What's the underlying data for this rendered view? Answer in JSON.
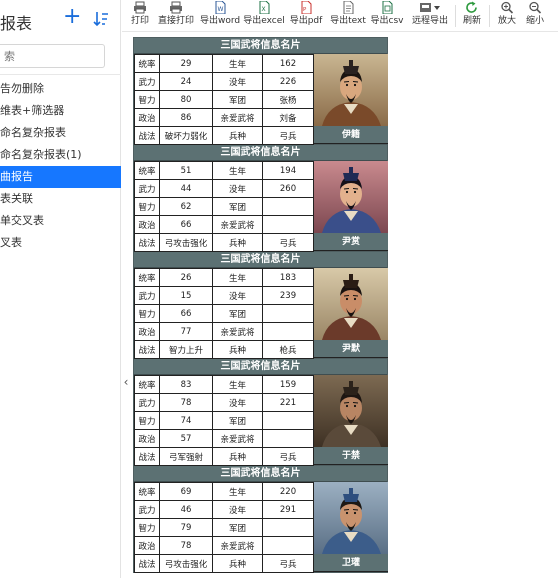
{
  "sidebar": {
    "title": "报表",
    "search_placeholder": "索",
    "items": [
      {
        "label": "告勿删除",
        "active": false
      },
      {
        "label": "维表+筛选器",
        "active": false
      },
      {
        "label": "命名复杂报表",
        "active": false
      },
      {
        "label": "命名复杂报表(1)",
        "active": false
      },
      {
        "label": "曲报告",
        "active": true
      },
      {
        "label": "表关联",
        "active": false
      },
      {
        "label": "单交叉表",
        "active": false
      },
      {
        "label": "叉表",
        "active": false
      }
    ]
  },
  "toolbar": {
    "print": "打印",
    "direct_print": "直接打印",
    "export_word": "导出word",
    "export_excel": "导出excel",
    "export_pdf": "导出pdf",
    "export_text": "导出text",
    "export_csv": "导出csv",
    "remote_export": "远程导出",
    "refresh": "刷新",
    "zoom_in": "放大",
    "zoom_out": "缩小"
  },
  "report": {
    "card_title": "三国武将信息名片",
    "labels": {
      "tongshuai": "统率",
      "wuli": "武力",
      "zhili": "智力",
      "zhengzhi": "政治",
      "zhanfa": "战法",
      "shengnian": "生年",
      "monian": "没年",
      "juntuan": "军团",
      "qinai": "亲爱武将",
      "bingzhong": "兵种"
    },
    "generals": [
      {
        "name": "伊籍",
        "tongshuai": "29",
        "wuli": "24",
        "zhili": "80",
        "zhengzhi": "86",
        "zhanfa": "破坏力弱化",
        "shengnian": "162",
        "monian": "226",
        "juntuan": "张杨",
        "qinai": "刘备",
        "bingzhong": "弓兵"
      },
      {
        "name": "尹赏",
        "tongshuai": "51",
        "wuli": "44",
        "zhili": "62",
        "zhengzhi": "66",
        "zhanfa": "弓攻击强化",
        "shengnian": "194",
        "monian": "260",
        "juntuan": "",
        "qinai": "",
        "bingzhong": "弓兵"
      },
      {
        "name": "尹默",
        "tongshuai": "26",
        "wuli": "15",
        "zhili": "66",
        "zhengzhi": "77",
        "zhanfa": "智力上升",
        "shengnian": "183",
        "monian": "239",
        "juntuan": "",
        "qinai": "",
        "bingzhong": "枪兵"
      },
      {
        "name": "于禁",
        "tongshuai": "83",
        "wuli": "78",
        "zhili": "74",
        "zhengzhi": "57",
        "zhanfa": "弓军强射",
        "shengnian": "159",
        "monian": "221",
        "juntuan": "",
        "qinai": "",
        "bingzhong": "弓兵"
      },
      {
        "name": "卫瓘",
        "tongshuai": "69",
        "wuli": "46",
        "zhili": "79",
        "zhengzhi": "78",
        "zhanfa": "弓攻击强化",
        "shengnian": "220",
        "monian": "291",
        "juntuan": "",
        "qinai": "",
        "bingzhong": "弓兵"
      }
    ]
  },
  "colors": {
    "accent": "#1677ff",
    "header_bg": "#5c7173"
  }
}
